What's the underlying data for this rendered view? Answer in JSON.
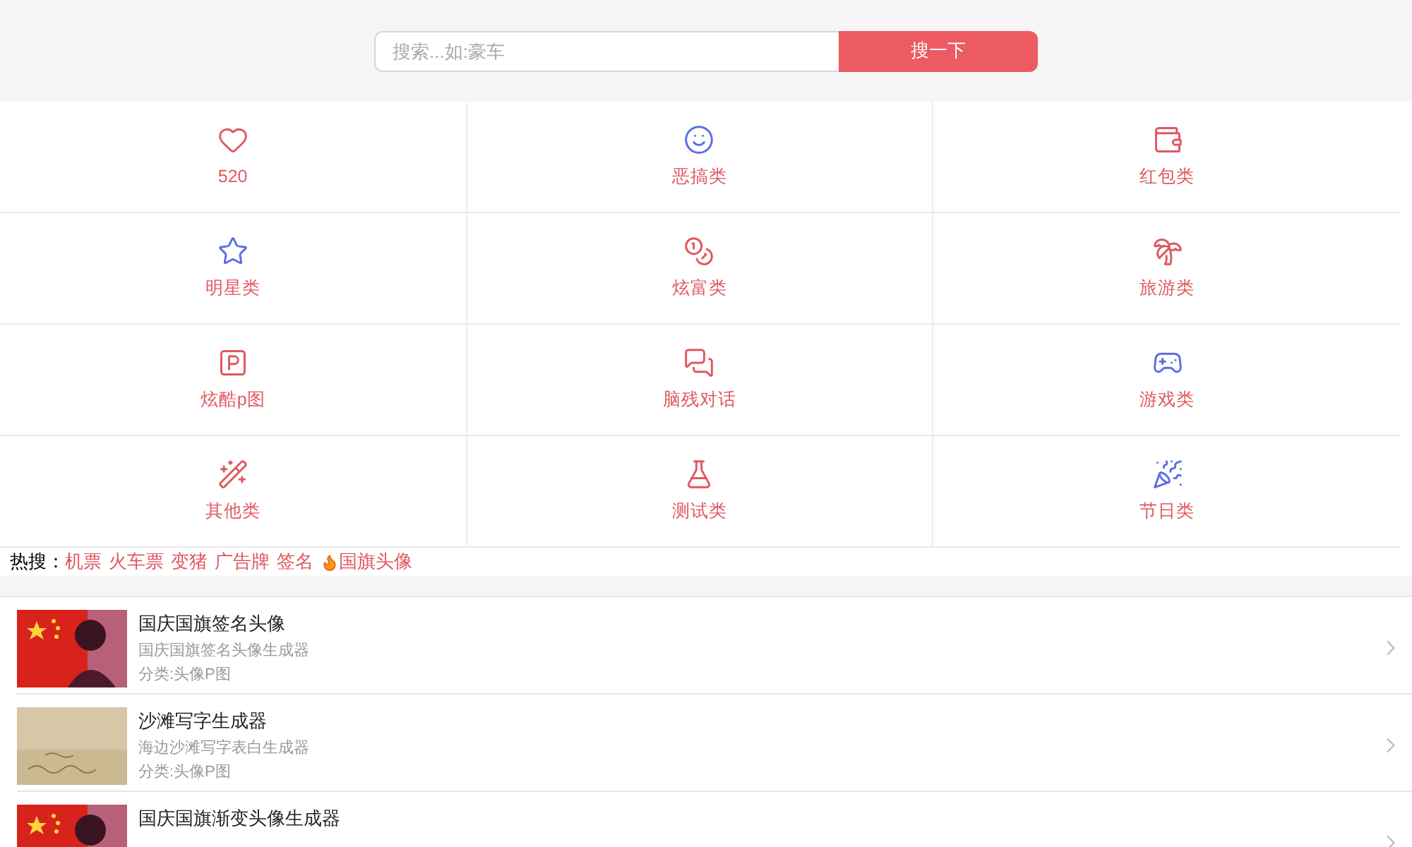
{
  "search": {
    "placeholder": "搜索...如:豪车",
    "button": "搜一下"
  },
  "categories": [
    {
      "label": "520"
    },
    {
      "label": "恶搞类"
    },
    {
      "label": "红包类"
    },
    {
      "label": "明星类"
    },
    {
      "label": "炫富类"
    },
    {
      "label": "旅游类"
    },
    {
      "label": "炫酷p图"
    },
    {
      "label": "脑残对话"
    },
    {
      "label": "游戏类"
    },
    {
      "label": "其他类"
    },
    {
      "label": "测试类"
    },
    {
      "label": "节日类"
    }
  ],
  "hot_search": {
    "label": "热搜：",
    "links": [
      {
        "text": "机票",
        "hot": false
      },
      {
        "text": "火车票",
        "hot": false
      },
      {
        "text": "变猪",
        "hot": false
      },
      {
        "text": "广告牌",
        "hot": false
      },
      {
        "text": "签名",
        "hot": false
      },
      {
        "text": "国旗头像",
        "hot": true
      }
    ]
  },
  "list": [
    {
      "title": "国庆国旗签名头像",
      "description": "国庆国旗签名头像生成器",
      "category": "分类:头像P图"
    },
    {
      "title": "沙滩写字生成器",
      "description": "海边沙滩写字表白生成器",
      "category": "分类:头像P图"
    },
    {
      "title": "国庆国旗渐变头像生成器"
    }
  ]
}
